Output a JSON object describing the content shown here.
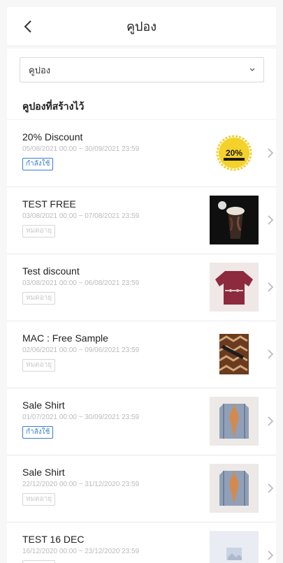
{
  "header": {
    "title": "คูปอง"
  },
  "filter": {
    "selected": "คูปอง"
  },
  "section": {
    "title": "คูปองที่สร้างไว้"
  },
  "colors": {
    "active": "#3a7bd5",
    "expired": "#c9c9c9",
    "badge_gold": "#f4d12b"
  },
  "coupons": [
    {
      "name": "20% Discount",
      "date": "05/08/2021 00:00 ~ 30/09/2021 23:59",
      "status": "กำลังใช้",
      "state": "active",
      "thumb": "20-percent-badge",
      "thumb_text": "20%"
    },
    {
      "name": "TEST FREE",
      "date": "03/08/2021 00:00 ~ 07/08/2021 23:59",
      "status": "หมดอายุ",
      "state": "expired",
      "thumb": "frappuccino-photo"
    },
    {
      "name": "Test discount",
      "date": "03/08/2021 00:00 ~ 06/08/2021 23:59",
      "status": "หมดอายุ",
      "state": "expired",
      "thumb": "sweater-photo"
    },
    {
      "name": "MAC : Free Sample",
      "date": "02/06/2021 00:00 ~ 09/06/2021 23:59",
      "status": "หมดอายุ",
      "state": "expired",
      "thumb": "pattern-photo"
    },
    {
      "name": "Sale Shirt",
      "date": "01/07/2021 00:00 ~ 30/09/2021 23:59",
      "status": "กำลังใช้",
      "state": "active",
      "thumb": "blazer-photo"
    },
    {
      "name": "Sale Shirt",
      "date": "22/12/2020 00:00 ~ 31/12/2020 23:59",
      "status": "หมดอายุ",
      "state": "expired",
      "thumb": "blazer-photo"
    },
    {
      "name": "TEST 16 DEC",
      "date": "16/12/2020 00:00 ~ 23/12/2020 23:59",
      "status": "หมดอายุ",
      "state": "expired",
      "thumb": "image-placeholder-icon"
    }
  ]
}
